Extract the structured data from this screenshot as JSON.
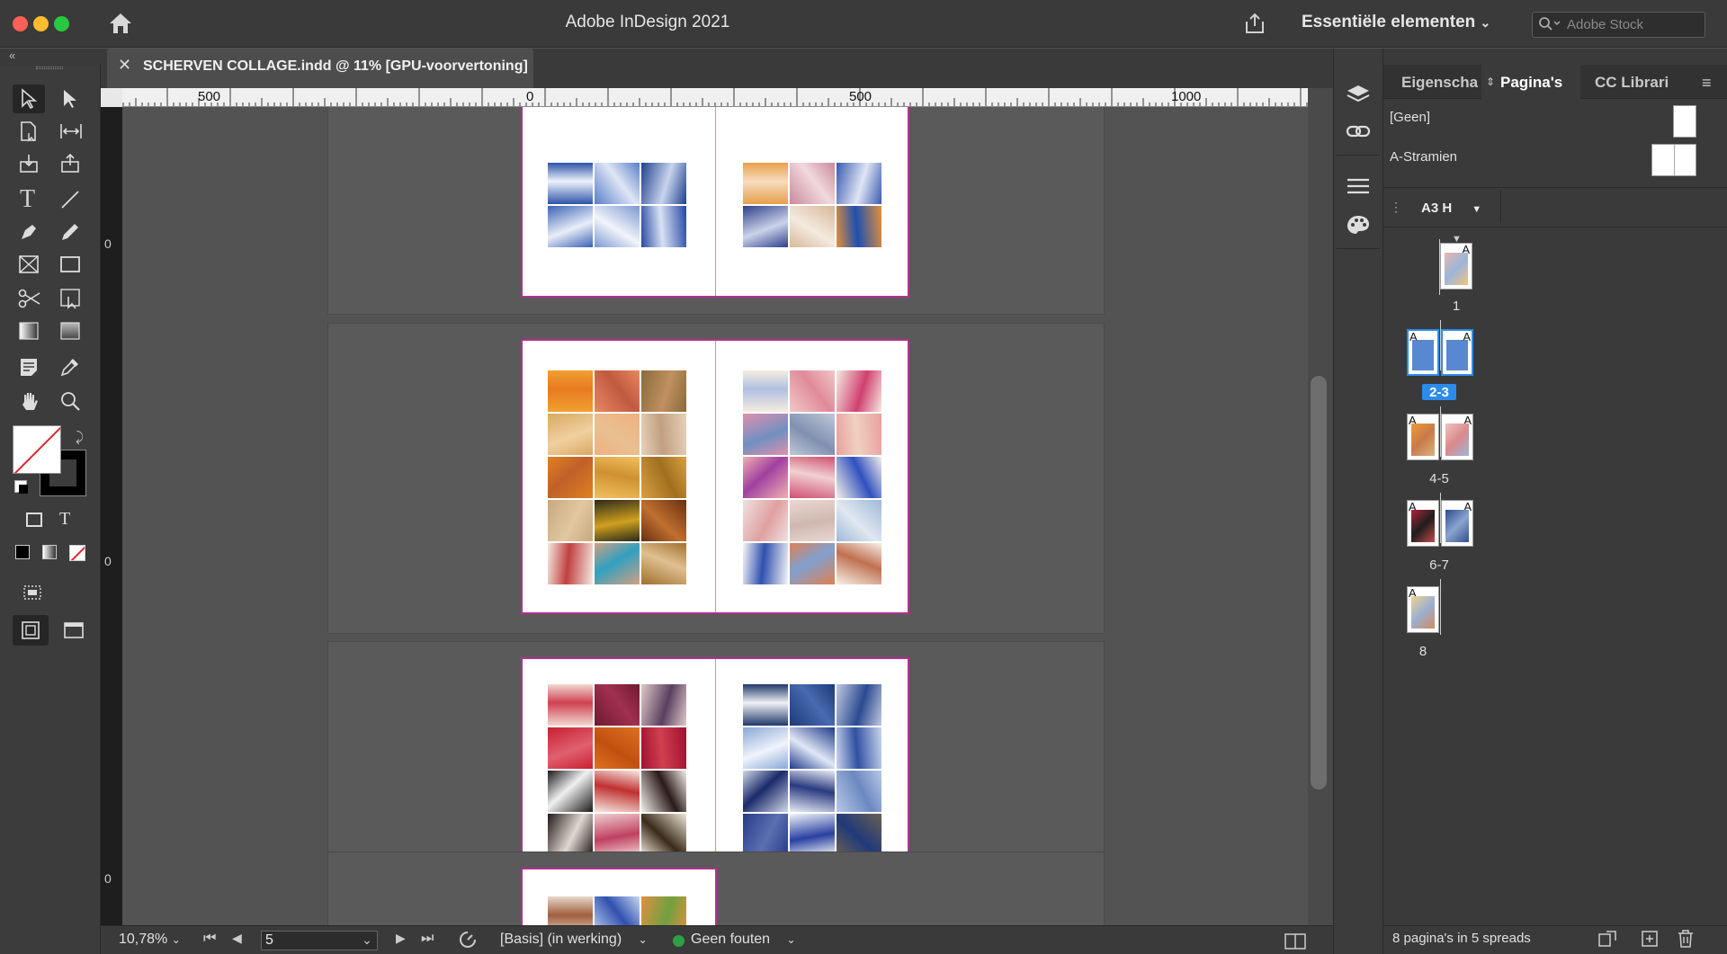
{
  "window": {
    "title": "Adobe InDesign 2021",
    "workspace_label": "Essentiële elementen",
    "stock_search_placeholder": "Adobe Stock"
  },
  "document_tab": {
    "label": "SCHERVEN COLLAGE.indd @ 11% [GPU-voorvertoning]"
  },
  "ruler": {
    "h_ticks": [
      "500",
      "0",
      "500",
      "1000"
    ],
    "v_ticks": [
      "0",
      "0",
      "0"
    ]
  },
  "status_bar": {
    "zoom": "10,78%",
    "current_page": "5",
    "preflight_profile": "[Basis] (in werking)",
    "preflight_status": "Geen fouten"
  },
  "panel": {
    "tabs": [
      "Eigenscha",
      "Pagina's",
      "CC Librari"
    ],
    "active_tab": "Pagina's",
    "masters": [
      "[Geen]",
      "A-Stramien"
    ],
    "page_size": "A3 H",
    "spreads": [
      {
        "label": "1",
        "master_prefixes": [
          "A"
        ],
        "selected": false
      },
      {
        "label": "2-3",
        "master_prefixes": [
          "A",
          "A"
        ],
        "selected": true
      },
      {
        "label": "4-5",
        "master_prefixes": [
          "A",
          "A"
        ],
        "selected": false
      },
      {
        "label": "6-7",
        "master_prefixes": [
          "A",
          "A"
        ],
        "selected": false
      },
      {
        "label": "8",
        "master_prefixes": [
          "A"
        ],
        "selected": false
      }
    ],
    "footer_text": "8 pagina's in 5 spreads"
  },
  "icons": {
    "home": "home-icon",
    "share": "share-icon",
    "search": "search-icon"
  },
  "colors": {
    "accent_selected": "#2d8ceb",
    "page_border": "#b3308f",
    "status_ok": "#2ea043"
  }
}
